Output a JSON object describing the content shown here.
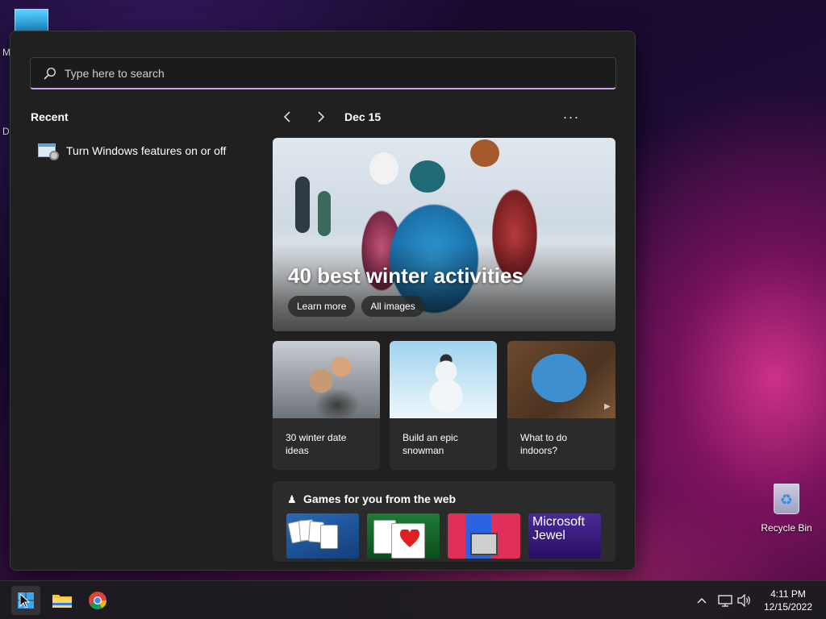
{
  "desktop": {
    "left_letters": [
      "M",
      "D"
    ],
    "recycle_bin_label": "Recycle Bin"
  },
  "start_menu": {
    "search": {
      "placeholder": "Type here to search",
      "value": ""
    },
    "recent": {
      "title": "Recent",
      "items": [
        {
          "label": "Turn Windows features on or off",
          "icon": "windows-features-icon"
        }
      ]
    },
    "feed": {
      "date": "Dec 15",
      "more_label": "···",
      "hero": {
        "title": "40 best winter activities",
        "buttons": [
          "Learn more",
          "All images"
        ]
      },
      "cards": [
        {
          "caption": "30 winter date ideas"
        },
        {
          "caption": "Build an epic snowman"
        },
        {
          "caption": "What to do indoors?"
        }
      ],
      "games": {
        "title": "Games for you from the web",
        "tiles": [
          {
            "name": "solitaire-collection",
            "text": ""
          },
          {
            "name": "spider-solitaire",
            "text": ""
          },
          {
            "name": "pixel-cat-game",
            "text": ""
          },
          {
            "name": "microsoft-jewel",
            "text": "Microsoft Jewel"
          }
        ]
      }
    }
  },
  "taskbar": {
    "clock": {
      "time": "4:11 PM",
      "date": "12/15/2022"
    }
  },
  "colors": {
    "accent": "#c9a7e8",
    "panel": "#202020",
    "card": "#2b2b2b"
  }
}
